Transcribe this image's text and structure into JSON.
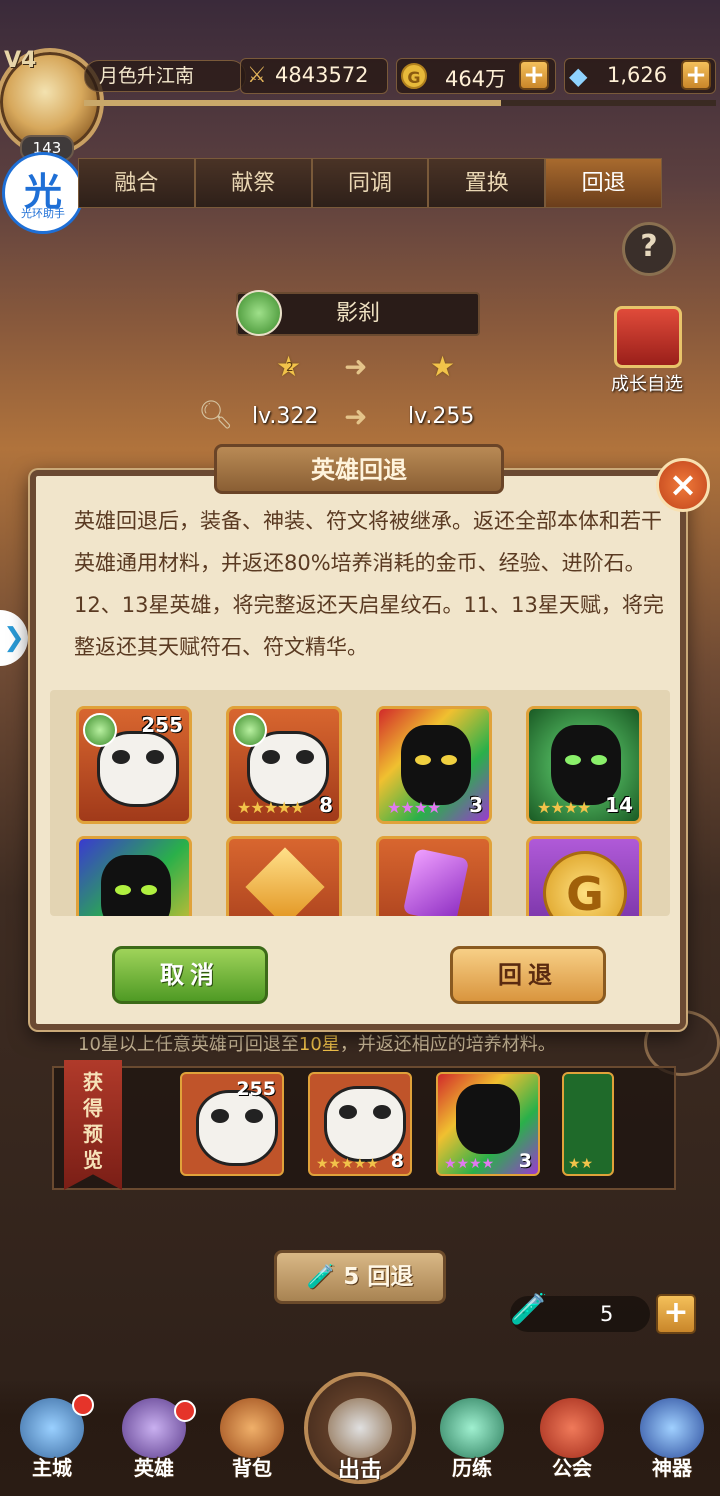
{
  "player": {
    "vip": "V4",
    "level": "143",
    "name": "月色升江南",
    "power": "4843572",
    "gold": "464万",
    "gems": "1,626",
    "xp_progress": 0.66
  },
  "helper": {
    "glyph": "光",
    "label": "光环助手"
  },
  "tabs": [
    "融合",
    "献祭",
    "同调",
    "置换",
    "回退"
  ],
  "active_tab": 4,
  "help_label": "?",
  "gift": {
    "label": "成长自选"
  },
  "hero": {
    "name": "影刹",
    "star_from": "2",
    "level_from": "lv.322",
    "level_to": "lv.255"
  },
  "dialog": {
    "title": "英雄回退",
    "close": "×",
    "description": "英雄回退后，装备、神装、符文将被继承。返还全部本体和若干英雄通用材料，并返还80%培养消耗的金币、经验、进阶石。12、13星英雄，将完整返还天启星纹石。11、13星天赋，将完整返还其天赋符石、符文精华。",
    "rewards": [
      {
        "name": "panda-hero",
        "count": "255"
      },
      {
        "name": "panda-hero-fragment",
        "count": "8",
        "stars": "★★★★★"
      },
      {
        "name": "rainbow-demon",
        "count": "3",
        "stars": "★★★★"
      },
      {
        "name": "green-demon",
        "count": "14",
        "stars": "★★★★"
      },
      {
        "name": "rainbow-demon-2"
      },
      {
        "name": "gold-crystal"
      },
      {
        "name": "purple-gem"
      },
      {
        "name": "gold-coin"
      }
    ],
    "cancel_label": "取消",
    "confirm_label": "回退"
  },
  "hint": {
    "pre": "10星以上任意英雄可回退至",
    "hl": "10星",
    "post": "，并返还相应的培养材料。"
  },
  "preview": {
    "ribbon": [
      "获",
      "得",
      "预",
      "览"
    ],
    "items": [
      {
        "count": "255"
      },
      {
        "count": "8",
        "stars": "★★★★★"
      },
      {
        "count": "3",
        "stars": "★★★★"
      },
      {
        "stars": "★★"
      }
    ]
  },
  "batch_button": "5 回退",
  "potion_count": "5",
  "nav": [
    {
      "label": "主城",
      "icon": "castle-icon",
      "dot": true
    },
    {
      "label": "英雄",
      "icon": "helmet-icon",
      "dot": true
    },
    {
      "label": "背包",
      "icon": "backpack-icon",
      "dot": false
    },
    {
      "label": "出击",
      "icon": "crossed-swords-icon",
      "dot": false
    },
    {
      "label": "历练",
      "icon": "training-icon",
      "dot": false
    },
    {
      "label": "公会",
      "icon": "guild-flag-icon",
      "dot": false
    },
    {
      "label": "神器",
      "icon": "artifact-orb-icon",
      "dot": false
    }
  ]
}
